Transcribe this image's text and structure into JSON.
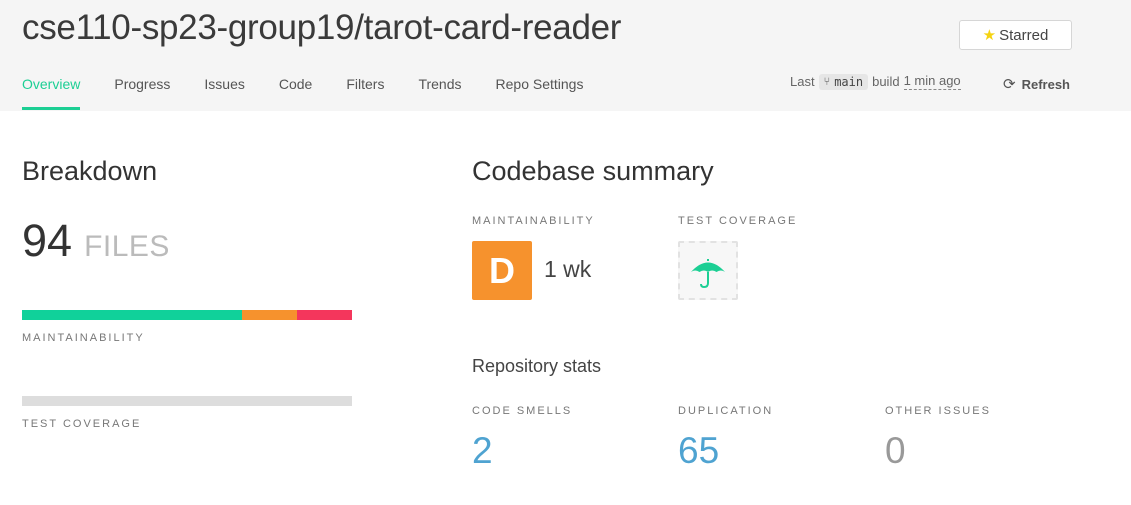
{
  "repo": {
    "title": "cse110-sp23-group19/tarot-card-reader"
  },
  "star_button": {
    "label": "Starred",
    "icon": "star-icon",
    "icon_color": "#f5d311"
  },
  "tabs": [
    {
      "label": "Overview",
      "active": true
    },
    {
      "label": "Progress"
    },
    {
      "label": "Issues"
    },
    {
      "label": "Code"
    },
    {
      "label": "Filters"
    },
    {
      "label": "Trends"
    },
    {
      "label": "Repo Settings"
    }
  ],
  "build": {
    "prefix": "Last",
    "branch": "main",
    "build_word": "build",
    "time": "1 min ago"
  },
  "refresh": {
    "label": "Refresh",
    "icon": "refresh-icon"
  },
  "breakdown": {
    "title": "Breakdown",
    "files_count": "94",
    "files_label": "FILES",
    "maintainability_label": "MAINTAINABILITY",
    "maintainability_distribution": [
      {
        "color": "#10d19a",
        "fraction": 0.667
      },
      {
        "color": "#f6922d",
        "fraction": 0.167
      },
      {
        "color": "#f4365c",
        "fraction": 0.166
      }
    ],
    "coverage_label": "TEST COVERAGE",
    "coverage_bar_color": "#dddddd"
  },
  "summary": {
    "title": "Codebase summary",
    "maintainability_label": "MAINTAINABILITY",
    "grade": "D",
    "grade_color": "#f6922d",
    "tech_debt": "1 wk",
    "coverage_label": "TEST COVERAGE",
    "coverage_icon": "umbrella-icon",
    "coverage_icon_color": "#1ccf94"
  },
  "stats": {
    "title": "Repository stats",
    "items": [
      {
        "label": "CODE SMELLS",
        "value": "2",
        "color": "#4fa3d1"
      },
      {
        "label": "DUPLICATION",
        "value": "65",
        "color": "#4fa3d1"
      },
      {
        "label": "OTHER ISSUES",
        "value": "0",
        "color": "#999999"
      }
    ]
  },
  "colors": {
    "accent": "#1ccf94",
    "header_bg": "#f5f5f5"
  }
}
